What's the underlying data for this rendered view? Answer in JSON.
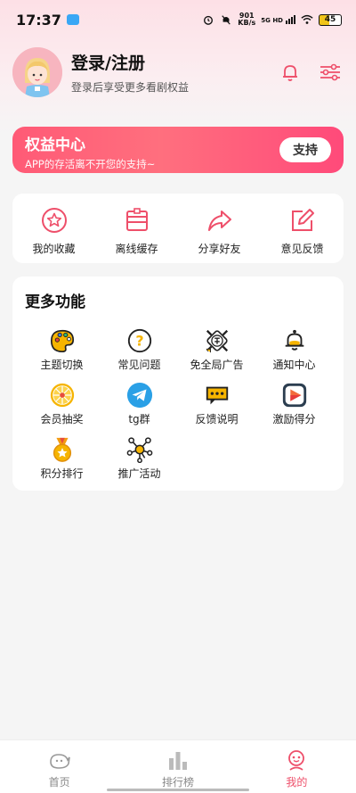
{
  "status": {
    "time": "17:37",
    "speed_value": "901",
    "speed_unit": "KB/s",
    "network": "5G HD",
    "battery": "45"
  },
  "profile": {
    "title": "登录/注册",
    "subtitle": "登录后享受更多看剧权益"
  },
  "banner": {
    "title": "权益中心",
    "subtitle": "APP的存活离不开您的支持~",
    "button": "支持"
  },
  "quick_actions": [
    {
      "label": "我的收藏",
      "icon": "star-circle-icon"
    },
    {
      "label": "离线缓存",
      "icon": "download-box-icon"
    },
    {
      "label": "分享好友",
      "icon": "share-arrow-icon"
    },
    {
      "label": "意见反馈",
      "icon": "edit-icon"
    }
  ],
  "more": {
    "title": "更多功能",
    "items": [
      {
        "label": "主题切换",
        "icon": "palette-icon"
      },
      {
        "label": "常见问题",
        "icon": "question-icon"
      },
      {
        "label": "免全局广告",
        "icon": "no-ads-icon"
      },
      {
        "label": "通知中心",
        "icon": "bell-icon"
      },
      {
        "label": "会员抽奖",
        "icon": "lottery-wheel-icon"
      },
      {
        "label": "tg群",
        "icon": "telegram-icon"
      },
      {
        "label": "反馈说明",
        "icon": "chat-bubble-icon"
      },
      {
        "label": "激励得分",
        "icon": "play-video-icon"
      },
      {
        "label": "积分排行",
        "icon": "medal-icon"
      },
      {
        "label": "推广活动",
        "icon": "network-icon"
      }
    ]
  },
  "tabs": [
    {
      "label": "首页",
      "icon": "home-icon"
    },
    {
      "label": "排行榜",
      "icon": "ranking-icon"
    },
    {
      "label": "我的",
      "icon": "profile-icon"
    }
  ],
  "colors": {
    "accent": "#ee4f6a",
    "banner_start": "#ff5a76",
    "banner_end": "#ff4a7a"
  }
}
